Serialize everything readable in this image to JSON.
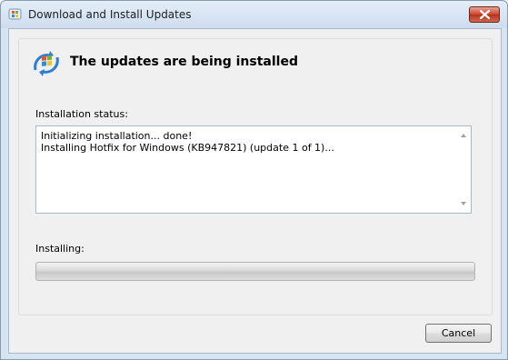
{
  "window": {
    "title": "Download and Install Updates",
    "app_icon": "windows-update-icon",
    "close_icon": "close-icon"
  },
  "header": {
    "icon": "windows-update-logo-icon",
    "heading": "The updates are being installed"
  },
  "status": {
    "label": "Installation status:",
    "lines": "Initializing installation... done!\nInstalling Hotfix for Windows (KB947821) (update 1 of 1)..."
  },
  "progress": {
    "label": "Installing:",
    "value_fraction": 0
  },
  "buttons": {
    "cancel_label": "Cancel"
  },
  "colors": {
    "close_button": "#c9452d",
    "accent": "#1e7ad6"
  }
}
